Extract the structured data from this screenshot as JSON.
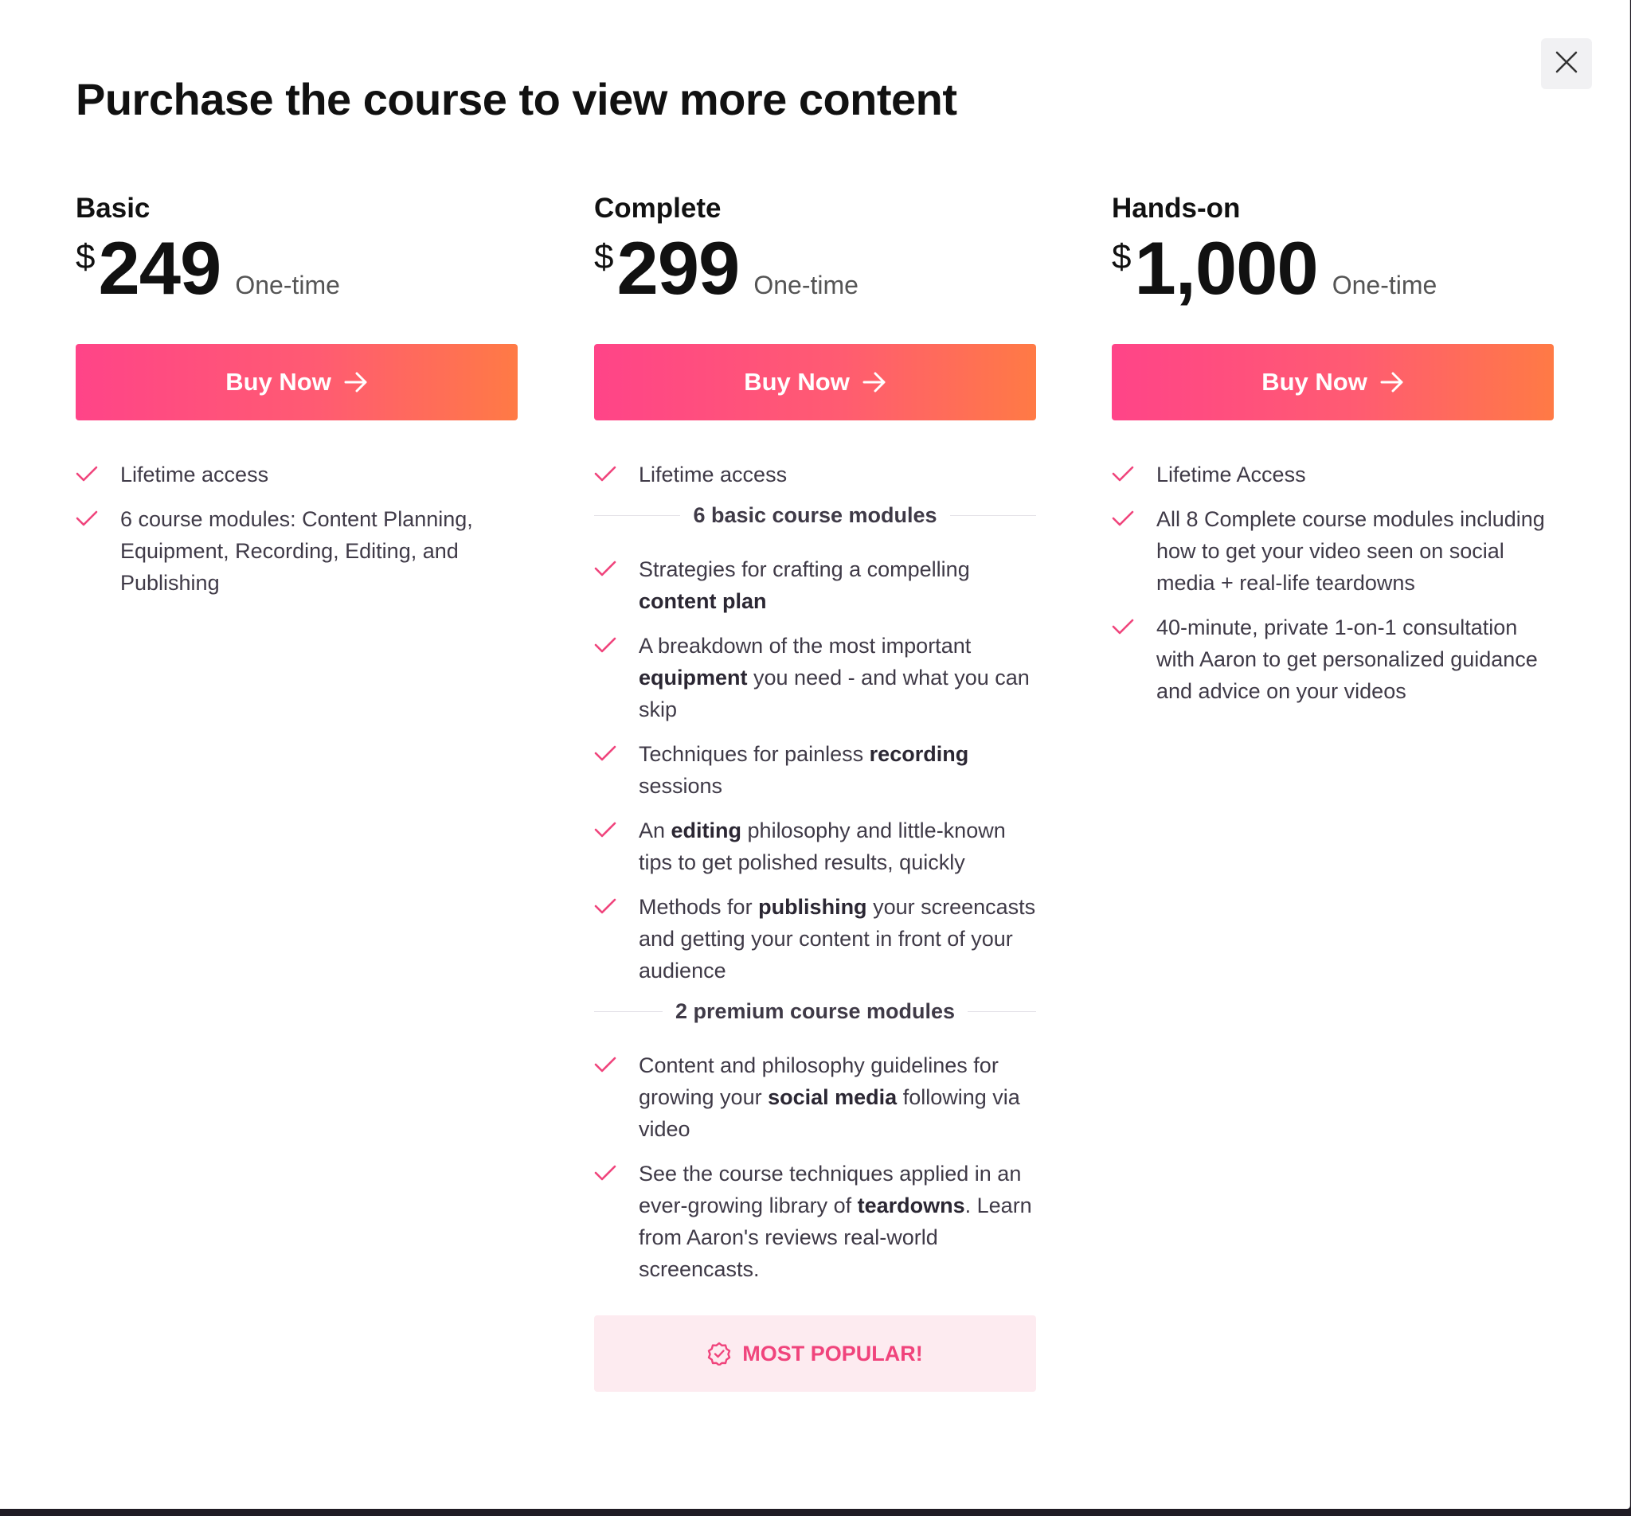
{
  "dialog": {
    "title": "Purchase the course to view more content",
    "close_icon": "close-icon"
  },
  "colors": {
    "gradient_start": "#ff4488",
    "gradient_end": "#ff7a45",
    "check": "#f0447c",
    "popular_bg": "#fdebf0",
    "popular_text": "#f0447c"
  },
  "plans": [
    {
      "name": "Basic",
      "currency": "$",
      "price": "249",
      "period": "One-time",
      "button_label": "Buy Now",
      "features": [
        "Lifetime access",
        "6 course modules: Content Planning, Equipment, Recording, Editing, and Publishing"
      ]
    },
    {
      "name": "Complete",
      "currency": "$",
      "price": "299",
      "period": "One-time",
      "button_label": "Buy Now",
      "features_top": [
        "Lifetime access"
      ],
      "section_basic": {
        "heading": "6 basic course modules",
        "items": [
          {
            "before": "Strategies for crafting a compelling ",
            "bold": "content plan",
            "after": ""
          },
          {
            "before": "A breakdown of the most important ",
            "bold": "equipment",
            "after": " you need - and what you can skip"
          },
          {
            "before": "Techniques for painless ",
            "bold": "recording",
            "after": " sessions"
          },
          {
            "before": "An ",
            "bold": "editing",
            "after": " philosophy and little-known tips to get polished results, quickly"
          },
          {
            "before": "Methods for ",
            "bold": "publishing",
            "after": " your screencasts and getting your content in front of your audience"
          }
        ]
      },
      "section_premium": {
        "heading": "2 premium course modules",
        "items": [
          {
            "before": "Content and philosophy guidelines for growing your ",
            "bold": "social media",
            "after": " following via video"
          },
          {
            "before": "See the course techniques applied in an ever-growing library of ",
            "bold": "teardowns",
            "after": ". Learn from Aaron's reviews real-world screencasts."
          }
        ]
      },
      "badge": "MOST POPULAR!"
    },
    {
      "name": "Hands-on",
      "currency": "$",
      "price": "1,000",
      "period": "One-time",
      "button_label": "Buy Now",
      "features": [
        "Lifetime Access",
        "All 8 Complete course modules including how to get your video seen on social media + real-life teardowns",
        "40-minute, private 1-on-1 consultation with Aaron to get personalized guidance and advice on your videos"
      ]
    }
  ]
}
